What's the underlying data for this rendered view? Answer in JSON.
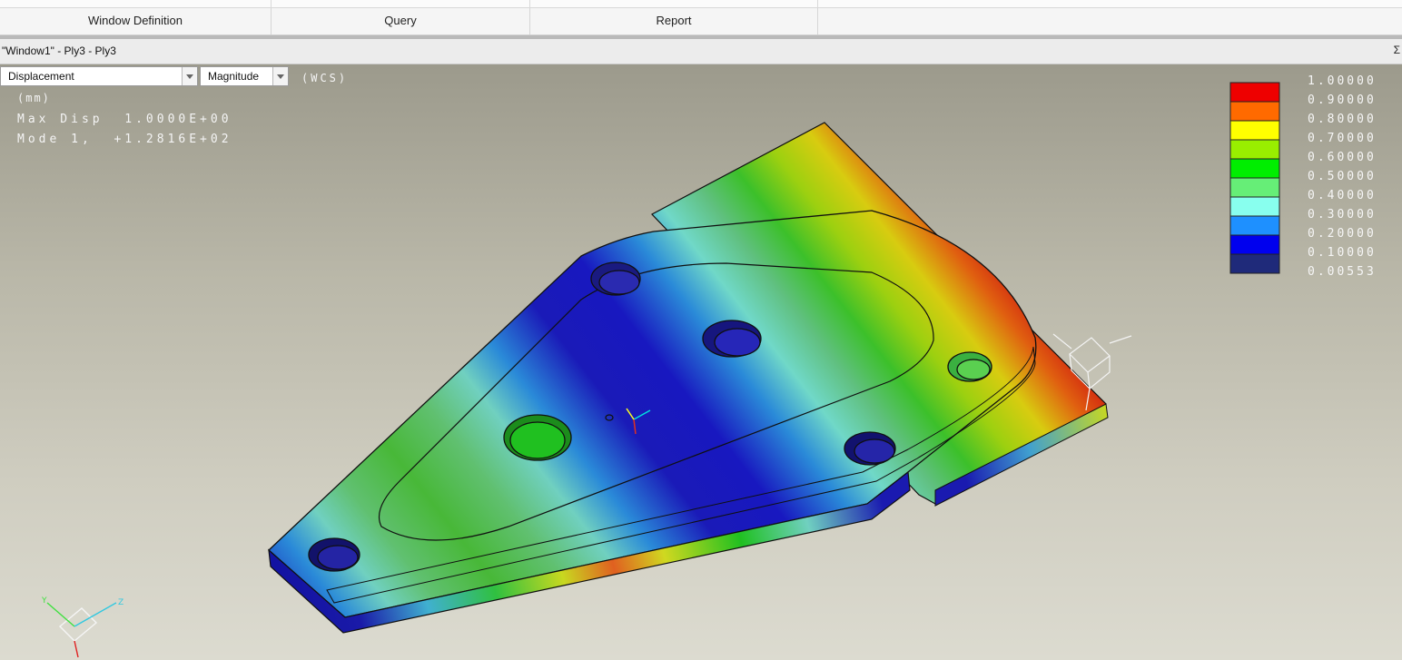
{
  "ribbon": {
    "groups": [
      "Window Definition",
      "Query",
      "Report"
    ]
  },
  "window": {
    "title": "\"Window1\" - Ply3 - Ply3",
    "sigma": "Σ"
  },
  "controls": {
    "quantity": "Displacement",
    "component": "Magnitude",
    "csys": "(WCS)"
  },
  "info": {
    "units": "(mm)",
    "max_disp": "Max Disp  1.0000E+00",
    "mode": "Mode 1,  +1.2816E+02"
  },
  "legend": {
    "labels": [
      "1.00000",
      "0.90000",
      "0.80000",
      "0.70000",
      "0.60000",
      "0.50000",
      "0.40000",
      "0.30000",
      "0.20000",
      "0.10000",
      "0.00553"
    ],
    "colors": [
      "#ee0000",
      "#ff6a00",
      "#ffff00",
      "#99ee00",
      "#00ee00",
      "#66ee77",
      "#88ffee",
      "#1e90ff",
      "#0000ee",
      "#1f2a7a"
    ]
  }
}
